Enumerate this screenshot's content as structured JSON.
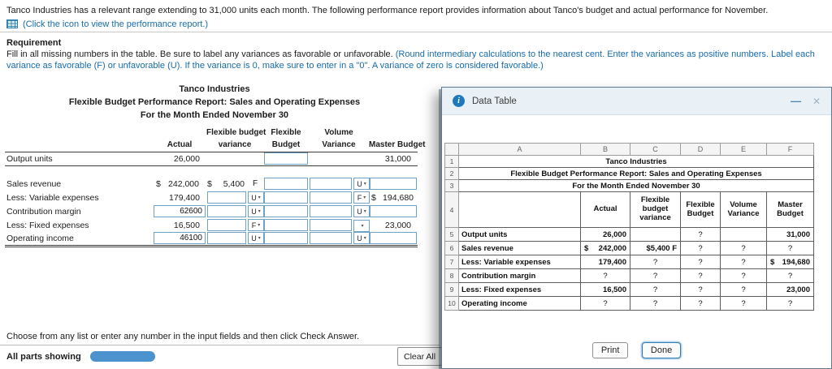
{
  "intro": {
    "text": "Tanco Industries has a relevant range extending to 31,000 units each month. The following performance report provides information about Tanco's budget and actual performance for November.",
    "link": "(Click the icon to view the performance report.)"
  },
  "requirement": {
    "heading": "Requirement",
    "text_main": "Fill in all missing numbers in the table. Be sure to label any variances as favorable or unfavorable. ",
    "text_note": "(Round intermediary calculations to the nearest cent. Enter the variances as positive numbers. Label each variance as favorable (F) or unfavorable (U). If the variance is 0, make sure to enter in a \"0\". A variance of zero is considered favorable.)"
  },
  "worksheet": {
    "title1": "Tanco Industries",
    "title2": "Flexible Budget Performance Report: Sales and Operating Expenses",
    "title3": "For the Month Ended November 30",
    "headers": {
      "actual": "Actual",
      "fbv_line1": "Flexible budget",
      "fbv_line2": "variance",
      "flex_line1": "Flexible",
      "flex_line2": "Budget",
      "vol_line1": "Volume",
      "vol_line2": "Variance",
      "master": "Master Budget"
    },
    "rows": {
      "output_units": {
        "label": "Output units",
        "actual": "26,000",
        "flexible_budget_value": "",
        "master": "31,000"
      },
      "sales_revenue": {
        "label": "Sales revenue",
        "actual_dollar": "$",
        "actual": "242,000",
        "variance_dollar": "$",
        "variance": "5,400",
        "variance_flag": "F",
        "flexible_budget_value": "",
        "volume_variance_value": "",
        "volume_variance_flag": "U",
        "master_value": ""
      },
      "variable_expenses": {
        "label": "Less: Variable expenses",
        "actual": "179,400",
        "variance_value": "",
        "variance_flag": "U",
        "flexible_budget_value": "",
        "volume_variance_value": "",
        "volume_variance_flag": "F",
        "master_dollar": "$",
        "master": "194,680"
      },
      "contribution_margin": {
        "label": "Contribution margin",
        "actual_value": "62600",
        "variance_value": "",
        "variance_flag": "U",
        "flexible_budget_value": "",
        "volume_variance_value": "",
        "volume_variance_flag": "U",
        "master_value": ""
      },
      "fixed_expenses": {
        "label": "Less: Fixed expenses",
        "actual": "16,500",
        "variance_value": "",
        "variance_flag": "F",
        "flexible_budget_value": "",
        "volume_variance_value": "",
        "volume_variance_flag": "",
        "master": "23,000"
      },
      "operating_income": {
        "label": "Operating income",
        "actual_value": "46100",
        "variance_value": "",
        "variance_flag": "U",
        "flexible_budget_value": "",
        "volume_variance_value": "",
        "volume_variance_flag": "U",
        "master_value": ""
      }
    }
  },
  "footer": {
    "prompt": "Choose from any list or enter any number in the input fields and then click Check Answer.",
    "all_parts": "All parts showing",
    "clear_all": "Clear All"
  },
  "dialog": {
    "title": "Data Table",
    "columns": [
      "A",
      "B",
      "C",
      "D",
      "E",
      "F"
    ],
    "row_numbers": [
      "1",
      "2",
      "3",
      "4",
      "5",
      "6",
      "7",
      "8",
      "9",
      "10"
    ],
    "titles": {
      "r1": "Tanco Industries",
      "r2": "Flexible Budget Performance Report: Sales and Operating Expenses",
      "r3": "For the Month Ended November 30"
    },
    "headers": {
      "b": "Actual",
      "c": "Flexible budget variance",
      "d": "Flexible Budget",
      "e": "Volume Variance",
      "f": "Master Budget"
    },
    "grid": {
      "r5": {
        "label": "Output units",
        "b": "26,000",
        "c": "",
        "d": "?",
        "e": "",
        "f": "31,000"
      },
      "r6": {
        "label": "Sales revenue",
        "b_dollar": "$",
        "b": "242,000",
        "c": "$5,400 F",
        "d": "?",
        "e": "?",
        "f": "?"
      },
      "r7": {
        "label": "Less: Variable expenses",
        "b": "179,400",
        "c": "?",
        "d": "?",
        "e": "?",
        "f_dollar": "$",
        "f": "194,680"
      },
      "r8": {
        "label": "Contribution margin",
        "b": "?",
        "c": "?",
        "d": "?",
        "e": "?",
        "f": "?"
      },
      "r9": {
        "label": "Less: Fixed expenses",
        "b": "16,500",
        "c": "?",
        "d": "?",
        "e": "?",
        "f": "23,000"
      },
      "r10": {
        "label": "Operating income",
        "b": "?",
        "c": "?",
        "d": "?",
        "e": "?",
        "f": "?"
      }
    },
    "print": "Print",
    "done": "Done"
  },
  "icons": {
    "report_icon": "spreadsheet-grid",
    "info": "i",
    "minimize": "—",
    "close": "✕"
  }
}
